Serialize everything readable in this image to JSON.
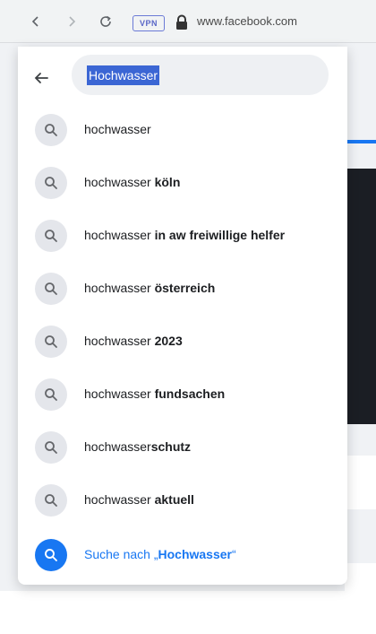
{
  "browser": {
    "vpn_label": "VPN",
    "url": "www.facebook.com"
  },
  "search": {
    "query": "Hochwasser"
  },
  "suggestions": [
    {
      "base": "hochwasser",
      "rest": ""
    },
    {
      "base": "hochwasser",
      "rest": " köln"
    },
    {
      "base": "hochwasser",
      "rest": " in aw freiwillige helfer"
    },
    {
      "base": "hochwasser",
      "rest": " österreich"
    },
    {
      "base": "hochwasser",
      "rest": " 2023"
    },
    {
      "base": "hochwasser",
      "rest": " fundsachen"
    },
    {
      "base": "hochwasser",
      "rest": "schutz"
    },
    {
      "base": "hochwasser",
      "rest": " aktuell"
    }
  ],
  "search_for": {
    "prefix": "Suche nach „",
    "query": "Hochwasser",
    "suffix": "“"
  },
  "colors": {
    "accent": "#1877f2",
    "selection": "#3b66d4"
  },
  "icons": {
    "back": "arrow-left-icon",
    "suggestion": "search-icon",
    "search_for": "search-icon"
  }
}
